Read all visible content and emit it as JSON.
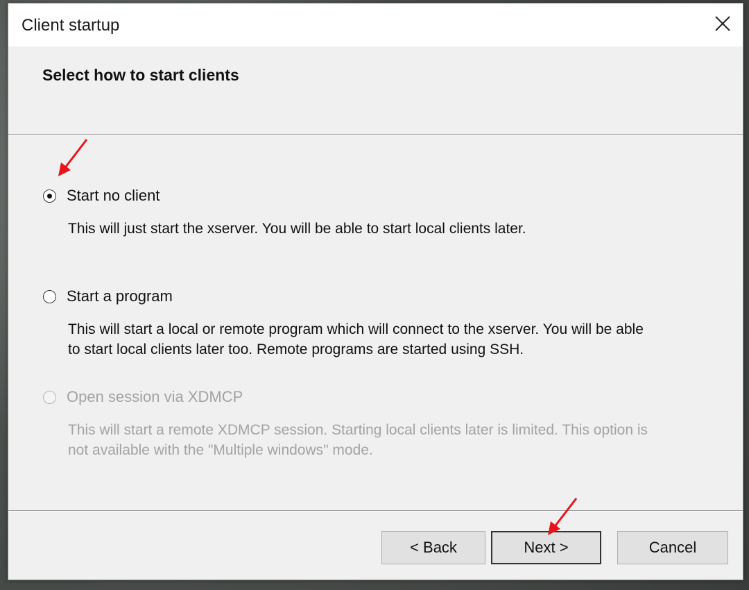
{
  "window": {
    "title": "Client startup"
  },
  "header": {
    "title": "Select how to start clients"
  },
  "options": [
    {
      "label": "Start no client",
      "description": "This will just start the xserver. You will be able to start local clients later.",
      "selected": true,
      "enabled": true
    },
    {
      "label": "Start a program",
      "description_line1": "This will start a local or remote program which will connect to the xserver. You will be able",
      "description_line2": "to start local clients later too. Remote programs are started using SSH.",
      "selected": false,
      "enabled": true
    },
    {
      "label": "Open session via XDMCP",
      "description_line1": "This will start a remote XDMCP session. Starting local clients later is limited. This option is",
      "description_line2": "not available with the \"Multiple windows\" mode.",
      "selected": false,
      "enabled": false
    }
  ],
  "buttons": {
    "back": "< Back",
    "next": "Next >",
    "cancel": "Cancel"
  },
  "annotations": {
    "arrow_color": "#e8141c"
  },
  "icons": {
    "close": "close-icon"
  }
}
